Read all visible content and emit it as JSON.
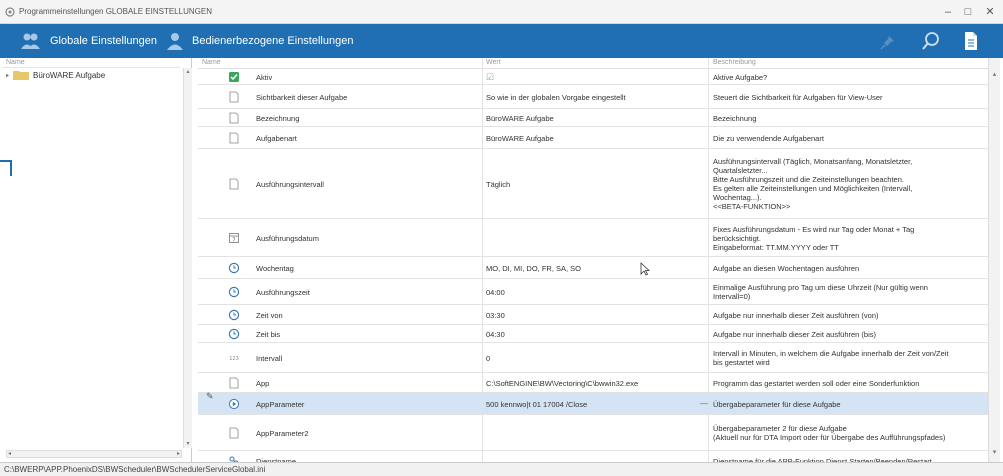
{
  "window": {
    "title": "Programmeinstellungen GLOBALE EINSTELLUNGEN",
    "minimize": "–",
    "maximize": "□",
    "close": "✕"
  },
  "toolbar": {
    "global_label": "Globale Einstellungen",
    "user_label": "Bedienerbezogene Einstellungen",
    "accent": "#1f6fb2"
  },
  "left_panel": {
    "header": "Name",
    "items": [
      {
        "label": "BüroWARE Aufgabe"
      }
    ]
  },
  "grid": {
    "headers": {
      "name": "Name",
      "value": "Wert",
      "desc": "Beschreibung"
    },
    "rows": [
      {
        "icon": "checkbox-icon",
        "name": "Aktiv",
        "value": "☑",
        "desc": "Aktive Aufgabe?"
      },
      {
        "icon": "document-icon",
        "name": "Sichtbarkeit dieser Aufgabe",
        "value": "So wie in der globalen Vorgabe eingestellt",
        "desc": "Steuert die Sichtbarkeit für Aufgaben für View-User"
      },
      {
        "icon": "document-icon",
        "name": "Bezeichnung",
        "value": "BüroWARE Aufgabe",
        "desc": "Bezeichnung"
      },
      {
        "icon": "document-icon",
        "name": "Aufgabenart",
        "value": "BüroWARE Aufgabe",
        "desc": "Die zu verwendende Aufgabenart"
      },
      {
        "icon": "document-icon",
        "name": "Ausführungsintervall",
        "value": "Täglich",
        "desc": "Ausführungsintervall (Täglich, Monatsanfang, Monatsletzter,\nQuartalsletzter...\nBitte Ausführungszeit und die Zeiteinstellungen beachten.\nEs gelten alle Zeiteinstellungen und Möglichkeiten (Intervall,\nWochentag...).\n<<BETA-FUNKTION>>"
      },
      {
        "icon": "calendar-icon",
        "name": "Ausführungsdatum",
        "value": "",
        "desc": "Fixes Ausführungsdatum - Es wird nur Tag oder Monat + Tag\nberücksichtigt.\nEingabeformat: TT.MM.YYYY oder TT"
      },
      {
        "icon": "clock-icon",
        "name": "Wochentag",
        "value": "MO, DI, MI, DO, FR, SA, SO",
        "desc": "Aufgabe an diesen Wochentagen ausführen"
      },
      {
        "icon": "clock-icon",
        "name": "Ausführungszeit",
        "value": "04:00",
        "desc": "Einmalige Ausführung pro Tag um diese Uhrzeit (Nur gültig wenn\nIntervall=0)"
      },
      {
        "icon": "clock-icon",
        "name": "Zeit von",
        "value": "03:30",
        "desc": "Aufgabe nur innerhalb dieser Zeit ausführen (von)"
      },
      {
        "icon": "clock-icon",
        "name": "Zeit bis",
        "value": "04:30",
        "desc": "Aufgabe nur innerhalb dieser Zeit ausführen (bis)"
      },
      {
        "icon": "number-icon",
        "name": "Intervall",
        "value": "0",
        "desc": "Intervall in Minuten, in welchem die Aufgabe innerhalb der Zeit von/Zeit\nbis gestartet wird"
      },
      {
        "icon": "document-icon",
        "name": "App",
        "value": "C:\\SoftENGINE\\BW\\Vectoring\\C\\bwwin32.exe",
        "desc": "Programm das gestartet werden soll oder eine Sonderfunktion"
      },
      {
        "icon": "play-circle-icon",
        "name": "AppParameter",
        "value": "500 kennwo|t 01 17004 /Close",
        "desc": "Übergabeparameter für diese Aufgabe",
        "selected": true
      },
      {
        "icon": "document-icon",
        "name": "AppParameter2",
        "value": "",
        "desc": "Übergabeparameter 2 für diese Aufgabe\n(Aktuell nur für DTA Import oder für Übergabe des Aufführungspfades)"
      },
      {
        "icon": "link-icon",
        "name": "Dienstname",
        "value": "",
        "desc": "Dienstname für die APP-Funktion Dienst Starten/Beenden/Restart"
      }
    ]
  },
  "statusbar": {
    "path": "C:\\BWERP\\APP.PhoenixDS\\BWScheduler\\BWSchedulerServiceGlobal.ini"
  }
}
